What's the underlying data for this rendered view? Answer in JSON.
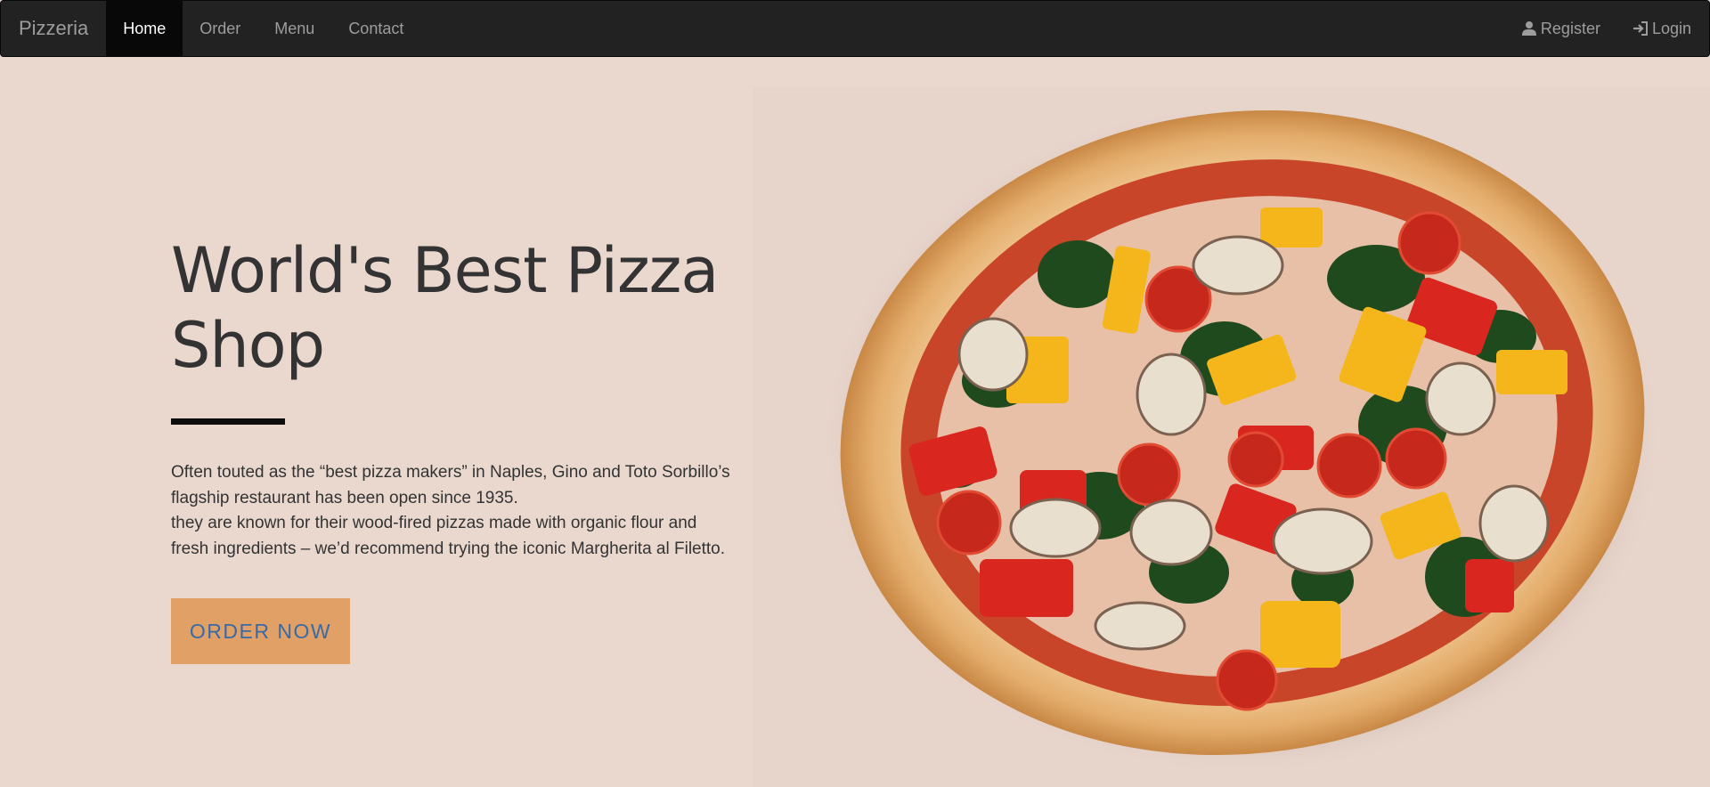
{
  "navbar": {
    "brand": "Pizzeria",
    "items": [
      {
        "label": "Home",
        "active": true
      },
      {
        "label": "Order",
        "active": false
      },
      {
        "label": "Menu",
        "active": false
      },
      {
        "label": "Contact",
        "active": false
      }
    ],
    "right_items": [
      {
        "label": "Register",
        "icon": "user-icon"
      },
      {
        "label": "Login",
        "icon": "login-icon"
      }
    ]
  },
  "hero": {
    "title": "World's Best Pizza Shop",
    "description_line1": "Often touted as the “best pizza makers” in Naples, Gino and Toto Sorbillo’s flagship restaurant has been open since 1935.",
    "description_line2": "they are known for their wood-fired pizzas made with organic flour and fresh ingredients – we’d recommend trying the iconic Margherita al Filetto.",
    "button_label": "ORDER NOW",
    "image": "pizza-image"
  },
  "colors": {
    "page_background": "#ead8cf",
    "navbar_background": "#222222",
    "button_background": "#e0a066",
    "button_text": "#3a6aa6",
    "title_text": "#333333"
  }
}
